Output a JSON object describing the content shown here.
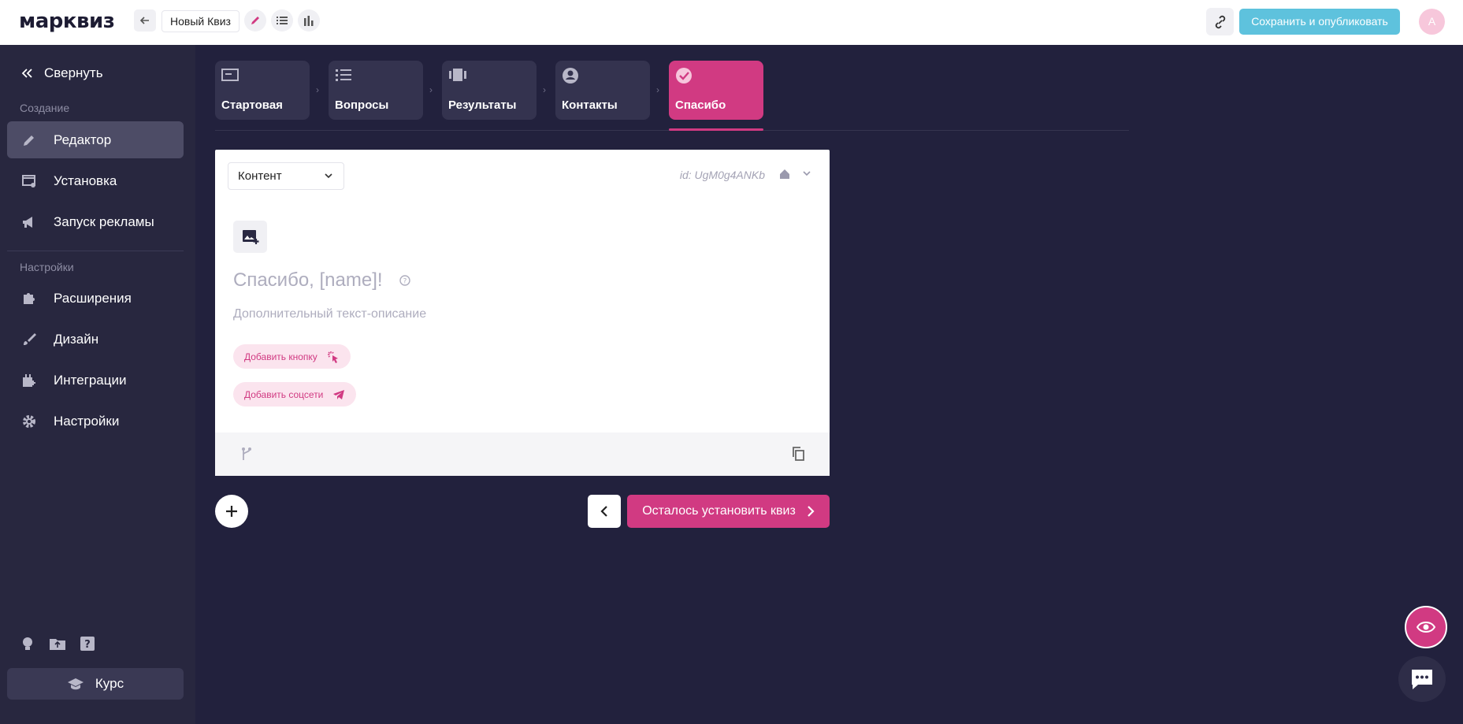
{
  "app": {
    "logo": "марквиз"
  },
  "topbar": {
    "quiz_name": "Новый Квиз",
    "publish_label": "Сохранить и опубликовать",
    "avatar_letter": "A"
  },
  "sidebar": {
    "collapse_label": "Свернуть",
    "section_create": "Создание",
    "section_settings": "Настройки",
    "items": [
      {
        "label": "Редактор"
      },
      {
        "label": "Установка"
      },
      {
        "label": "Запуск рекламы"
      },
      {
        "label": "Расширения"
      },
      {
        "label": "Дизайн"
      },
      {
        "label": "Интеграции"
      },
      {
        "label": "Настройки"
      }
    ],
    "course_label": "Курс"
  },
  "steps": [
    {
      "label": "Стартовая"
    },
    {
      "label": "Вопросы"
    },
    {
      "label": "Результаты"
    },
    {
      "label": "Контакты"
    },
    {
      "label": "Спасибо",
      "active": true
    }
  ],
  "card": {
    "select_value": "Контент",
    "id_text": "id: UgM0g4ANKb",
    "title": "Спасибо, [name]!",
    "description": "Дополнительный текст-описание",
    "add_button_label": "Добавить кнопку",
    "add_social_label": "Добавить соцсети"
  },
  "actions": {
    "next_label": "Осталось установить квиз"
  },
  "colors": {
    "accent": "#d13a82",
    "publish": "#5ec2dd",
    "background": "#22213d",
    "sidebar": "#28273f"
  }
}
